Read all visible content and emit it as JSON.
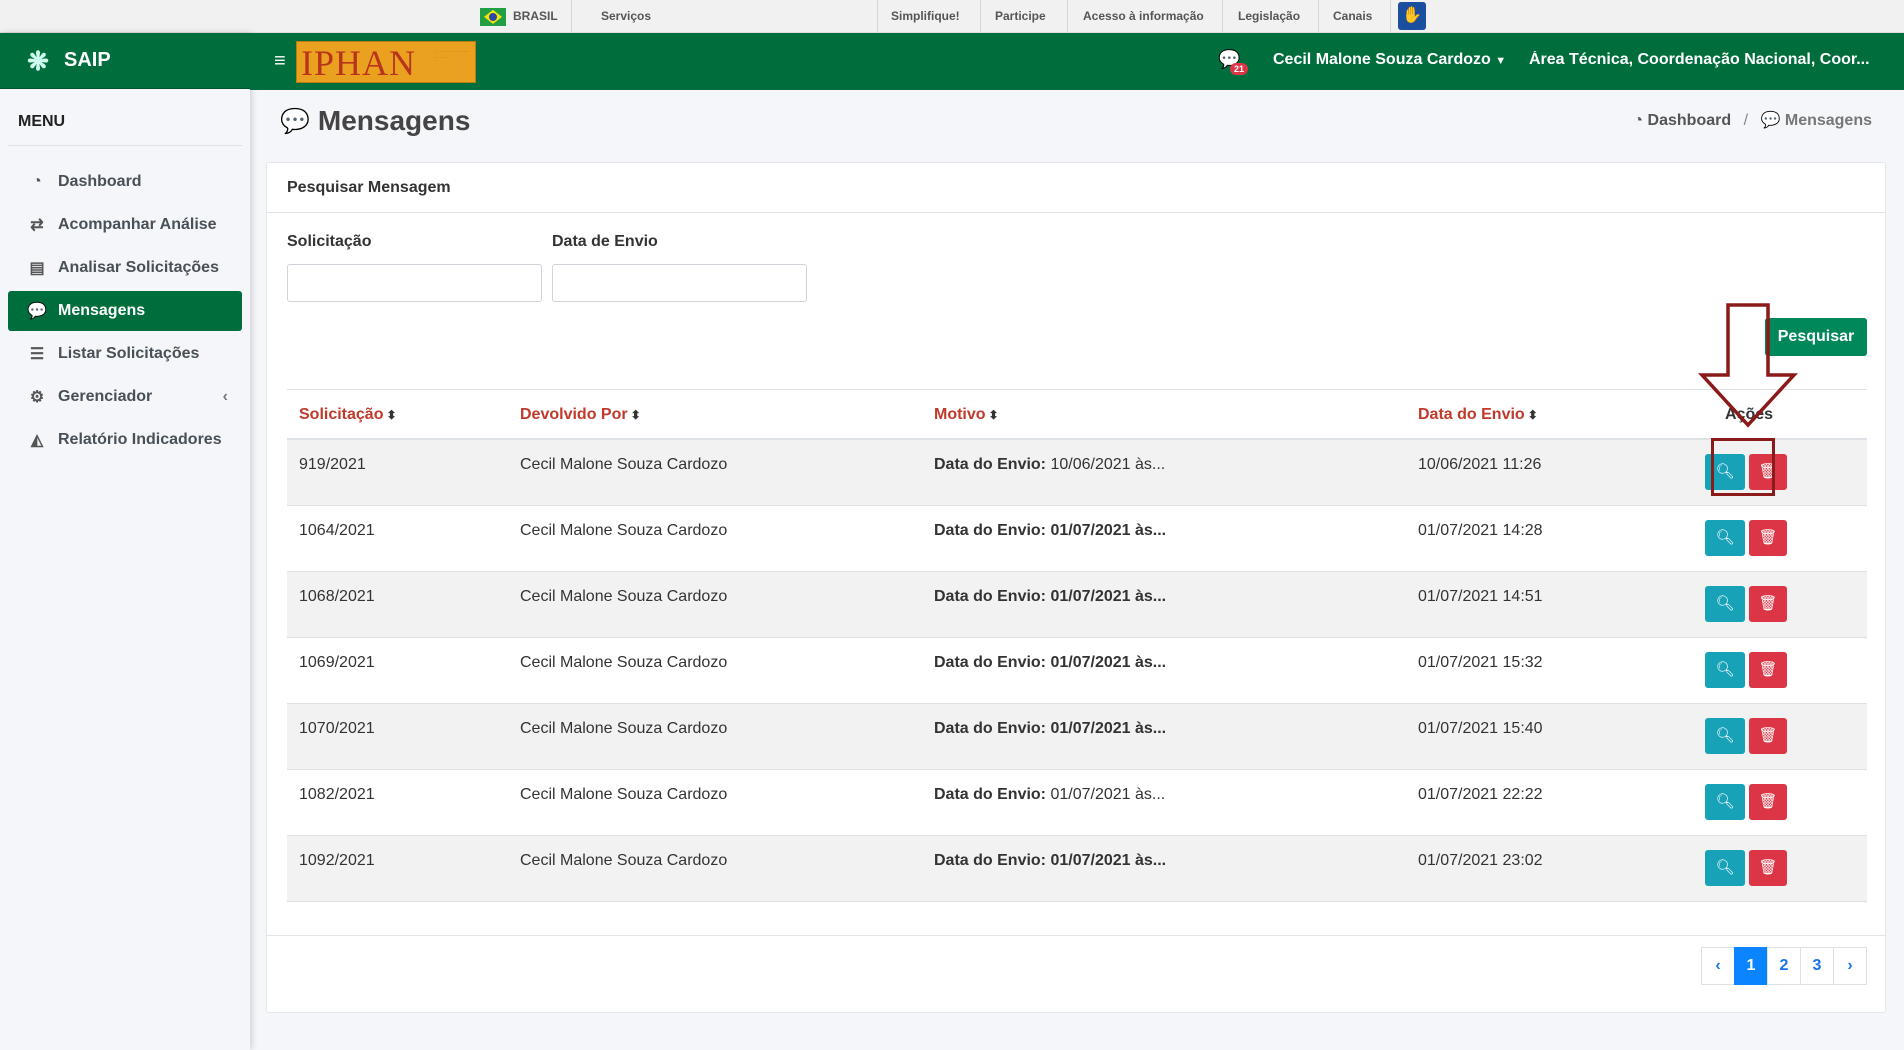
{
  "govbar": {
    "brasil": "BRASIL",
    "servicos": "Serviços",
    "links": [
      "Simplifique!",
      "Participe",
      "Acesso à informação",
      "Legislação",
      "Canais"
    ]
  },
  "sidebar": {
    "brand": "SAIP",
    "menu_title": "MENU",
    "items": [
      {
        "label": "Dashboard",
        "icon": "dashboard-icon"
      },
      {
        "label": "Acompanhar Análise",
        "icon": "exchange-icon"
      },
      {
        "label": "Analisar Solicitações",
        "icon": "book-icon"
      },
      {
        "label": "Mensagens",
        "icon": "comments-icon"
      },
      {
        "label": "Listar Solicitações",
        "icon": "list-icon"
      },
      {
        "label": "Gerenciador",
        "icon": "cogs-icon"
      },
      {
        "label": "Relatório Indicadores",
        "icon": "area-chart-icon"
      }
    ]
  },
  "header": {
    "logo_text": "IPHAN",
    "message_count": "21",
    "user": "Cecil Malone Souza Cardozo",
    "area": "Área Técnica, Coordenação Nacional, Coor..."
  },
  "page": {
    "title": "Mensagens",
    "breadcrumb": [
      "Dashboard",
      "Mensagens"
    ]
  },
  "search": {
    "card_title": "Pesquisar Mensagem",
    "field1_label": "Solicitação",
    "field1_value": "",
    "field2_label": "Data de Envio",
    "field2_value": "",
    "button": "Pesquisar"
  },
  "table": {
    "headers": [
      "Solicitação",
      "Devolvido Por",
      "Motivo",
      "Data do Envio",
      "Ações"
    ],
    "rows": [
      {
        "solicitacao": "919/2021",
        "devolvido": "Cecil Malone Souza Cardozo",
        "motivo_label": "Data do Envio:",
        "motivo_value": "10/06/2021 às...",
        "data": "10/06/2021 11:26",
        "bold": false
      },
      {
        "solicitacao": "1064/2021",
        "devolvido": "Cecil Malone Souza Cardozo",
        "motivo_label": "Data do Envio:",
        "motivo_value": "01/07/2021 às...",
        "data": "01/07/2021 14:28",
        "bold": true
      },
      {
        "solicitacao": "1068/2021",
        "devolvido": "Cecil Malone Souza Cardozo",
        "motivo_label": "Data do Envio:",
        "motivo_value": "01/07/2021 às...",
        "data": "01/07/2021 14:51",
        "bold": true
      },
      {
        "solicitacao": "1069/2021",
        "devolvido": "Cecil Malone Souza Cardozo",
        "motivo_label": "Data do Envio:",
        "motivo_value": "01/07/2021 às...",
        "data": "01/07/2021 15:32",
        "bold": true
      },
      {
        "solicitacao": "1070/2021",
        "devolvido": "Cecil Malone Souza Cardozo",
        "motivo_label": "Data do Envio:",
        "motivo_value": "01/07/2021 às...",
        "data": "01/07/2021 15:40",
        "bold": true
      },
      {
        "solicitacao": "1082/2021",
        "devolvido": "Cecil Malone Souza Cardozo",
        "motivo_label": "Data do Envio:",
        "motivo_value": "01/07/2021 às...",
        "data": "01/07/2021 22:22",
        "bold": false
      },
      {
        "solicitacao": "1092/2021",
        "devolvido": "Cecil Malone Souza Cardozo",
        "motivo_label": "Data do Envio:",
        "motivo_value": "01/07/2021 às...",
        "data": "01/07/2021 23:02",
        "bold": true
      }
    ]
  },
  "pagination": {
    "prev": "‹",
    "pages": [
      "1",
      "2",
      "3"
    ],
    "next": "›",
    "current": "1"
  },
  "colors": {
    "primary_green": "#006e3c",
    "header_red": "#c0392b",
    "view_button": "#17a2b8",
    "delete_button": "#dc3545",
    "annotation": "#8b1a1a"
  }
}
